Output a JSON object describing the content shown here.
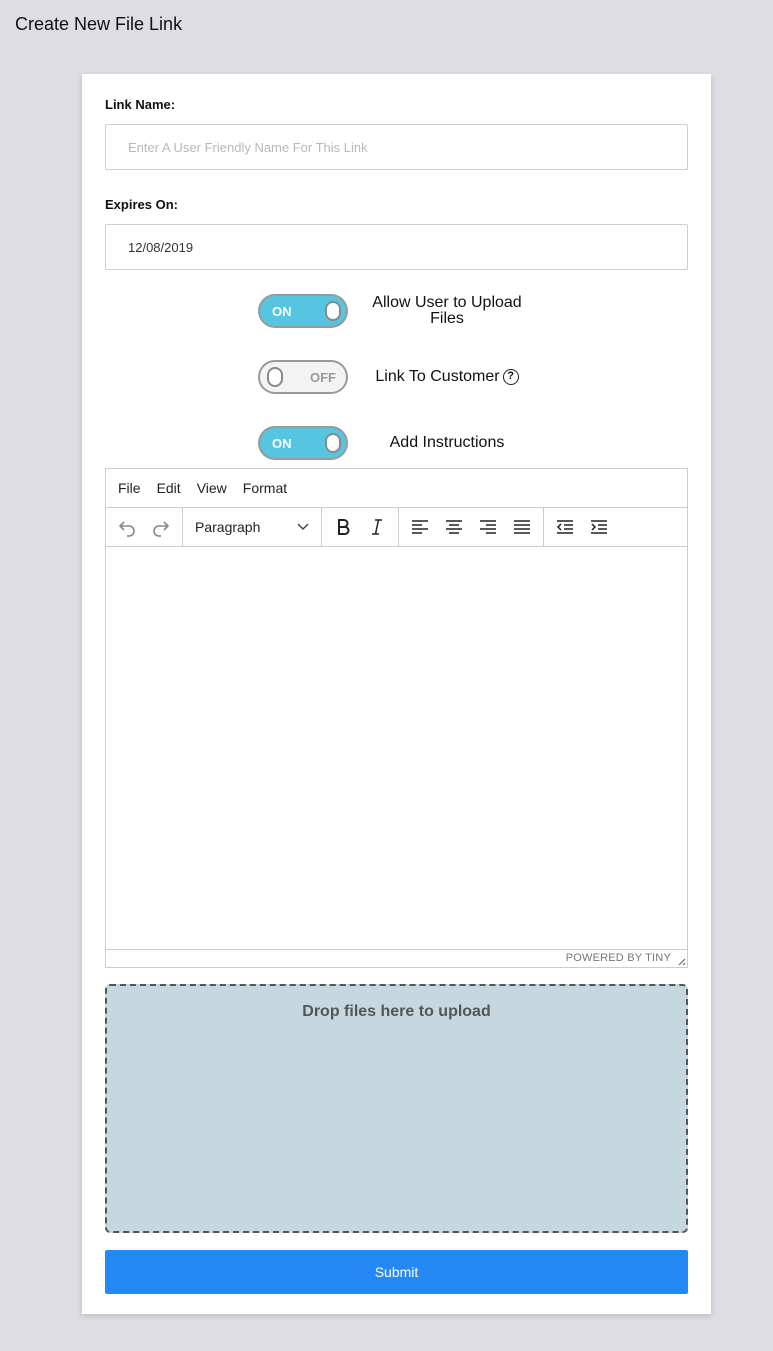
{
  "page": {
    "title": "Create New File Link"
  },
  "form": {
    "link_name": {
      "label": "Link Name:",
      "placeholder": "Enter A User Friendly Name For This Link",
      "value": ""
    },
    "expires_on": {
      "label": "Expires On:",
      "value": "12/08/2019"
    },
    "toggles": [
      {
        "state": "ON",
        "label": "Allow User to Upload Files",
        "on": true
      },
      {
        "state": "OFF",
        "label": "Link To Customer",
        "on": false,
        "help_icon": "question-circle-icon"
      },
      {
        "state": "ON",
        "label": "Add Instructions",
        "on": true
      }
    ],
    "editor": {
      "menu": [
        "File",
        "Edit",
        "View",
        "Format"
      ],
      "block_format": "Paragraph",
      "toolbar_icons": [
        "undo-icon",
        "redo-icon",
        "bold-icon",
        "italic-icon",
        "align-left-icon",
        "align-center-icon",
        "align-right-icon",
        "align-justify-icon",
        "outdent-icon",
        "indent-icon"
      ],
      "branding": "POWERED BY TINY",
      "content": ""
    },
    "dropzone": {
      "text": "Drop files here to upload"
    },
    "submit_label": "Submit"
  },
  "colors": {
    "toggle_on": "#56c5e2",
    "submit": "#2589f5",
    "dropzone": "#c6d8df",
    "background": "#dddde2"
  }
}
